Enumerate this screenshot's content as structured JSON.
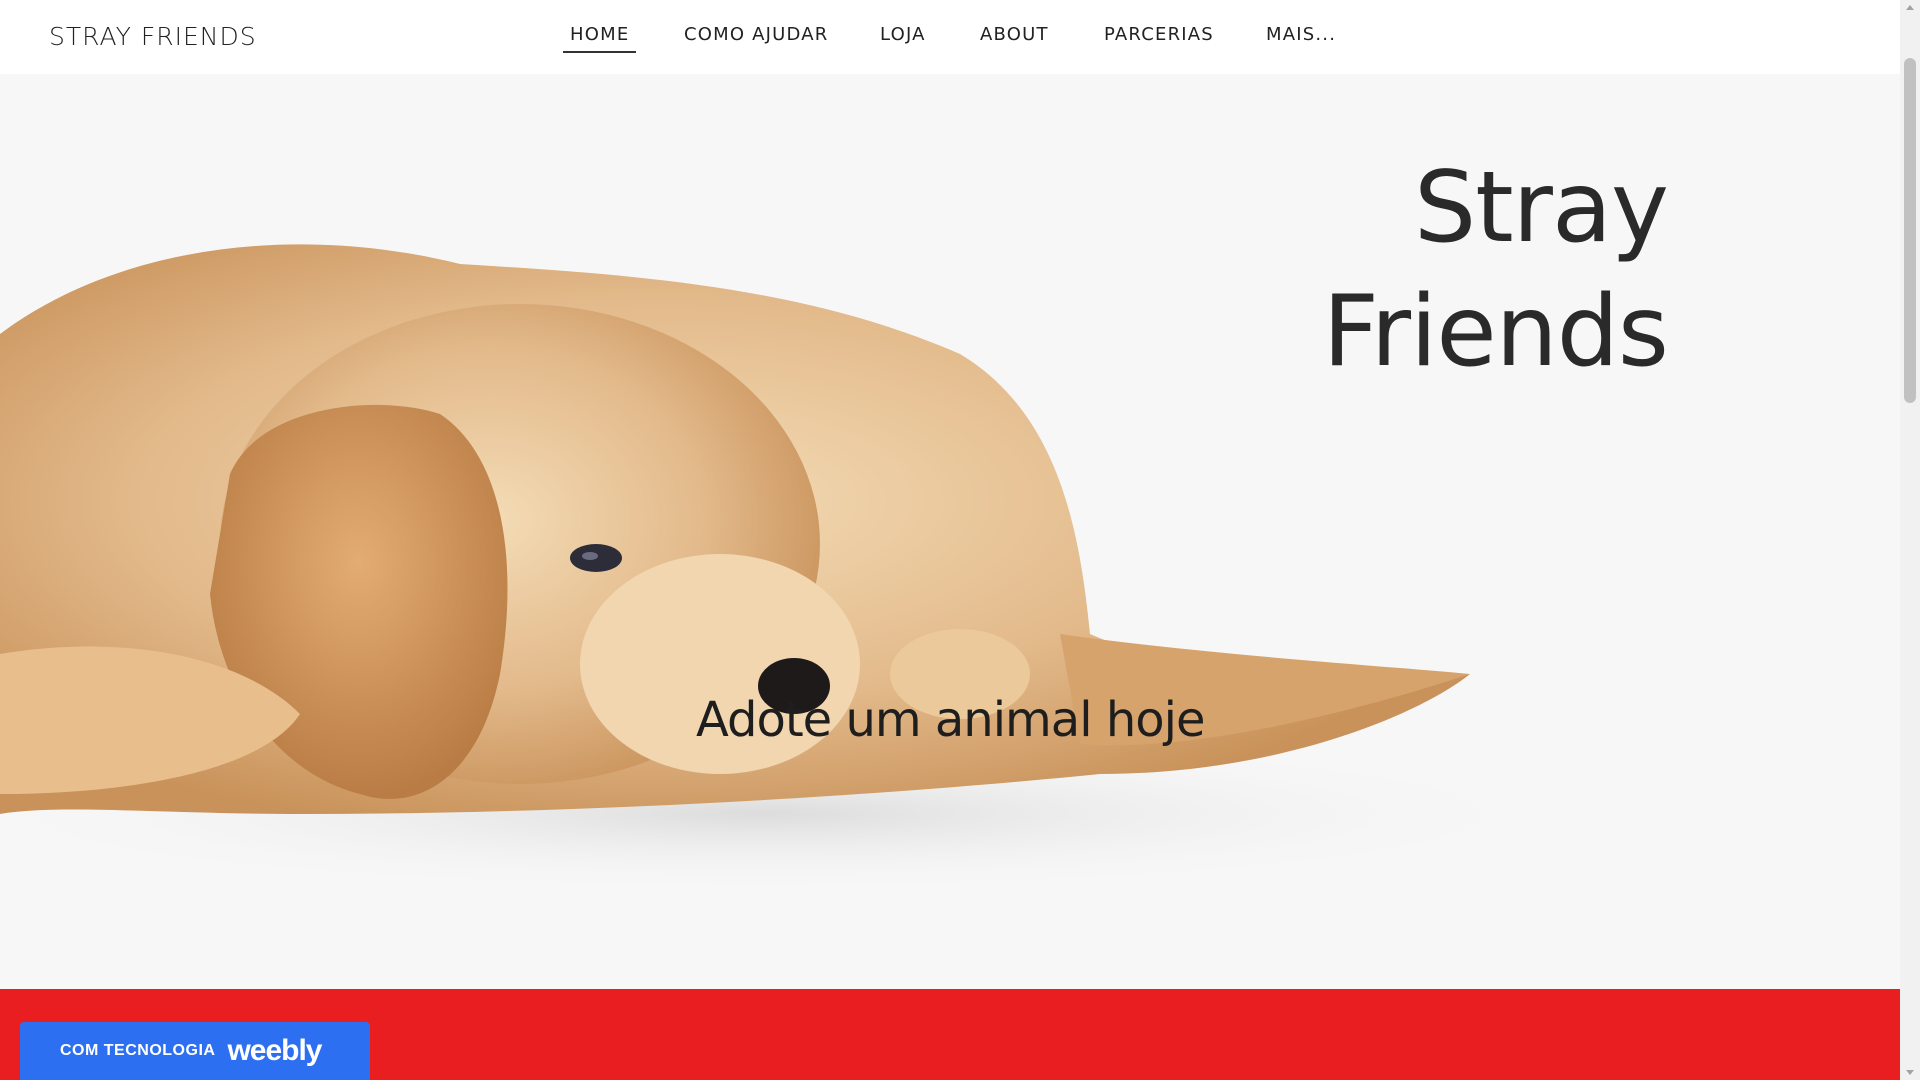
{
  "header": {
    "site_title": "STRAY FRIENDS",
    "nav": [
      {
        "label": "HOME",
        "active": true
      },
      {
        "label": "COMO AJUDAR",
        "active": false
      },
      {
        "label": "LOJA",
        "active": false
      },
      {
        "label": "ABOUT",
        "active": false
      },
      {
        "label": "PARCERIAS",
        "active": false
      },
      {
        "label": "MAIS...",
        "active": false
      }
    ]
  },
  "hero": {
    "headline_line1": "Stray",
    "headline_line2": "Friends",
    "subline": "Adote um animal hoje",
    "image": "golden-retriever-puppy-lying-down"
  },
  "footer_band": {
    "color": "#e81e21"
  },
  "badge": {
    "label": "COM TECNOLOGIA",
    "logo": "weebly",
    "color": "#2d6ff1"
  }
}
